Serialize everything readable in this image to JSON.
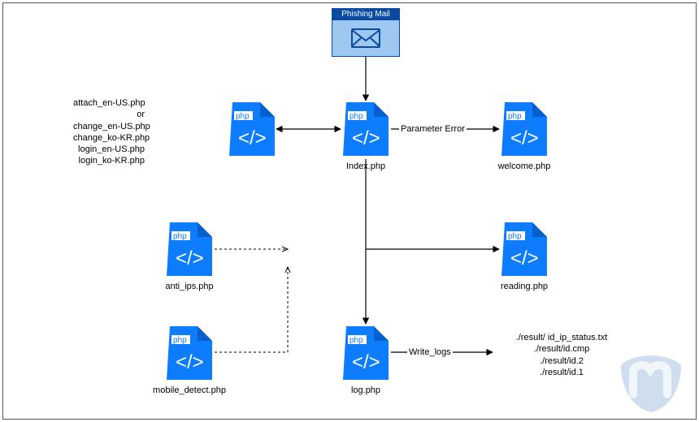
{
  "diagram": {
    "mail_label": "Phishing Mail",
    "files": {
      "index": {
        "label": "Index.php"
      },
      "welcome": {
        "label": "welcome.php"
      },
      "reading": {
        "label": "reading.php"
      },
      "log": {
        "label": "log.php"
      },
      "anti_ips": {
        "label": "anti_ips.php"
      },
      "mobile_detect": {
        "label": "mobile_detect.php"
      }
    },
    "attach_list": "attach_en-US.php\nor\nchange_en-US.php\nchange_ko-KR.php\nlogin_en-US.php\nlogin_ko-KR.php",
    "edges": {
      "param_error": "Parameter Error",
      "write_logs": "Write_logs"
    },
    "result_paths": "./result/ id_ip_status.txt\n./result/id.cmp\n./result/id.2\n./result/id.1"
  },
  "colors": {
    "php_blue": "#0d7cff",
    "php_blue_dark": "#0560ce",
    "mail_blue": "#0b4aa2",
    "mail_body": "#9ec8ef"
  }
}
